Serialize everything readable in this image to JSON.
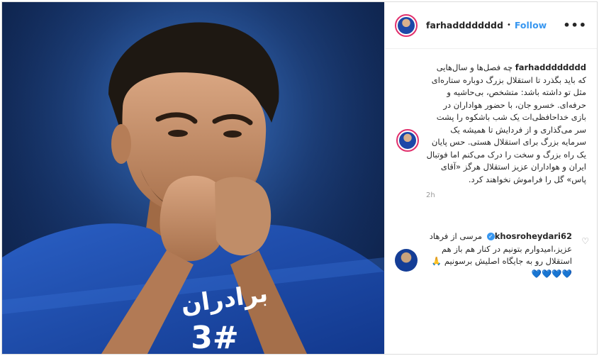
{
  "header": {
    "username": "farhadddddddd",
    "separator": "•",
    "follow_label": "Follow",
    "more_icon": "•••"
  },
  "caption": {
    "username": "farhadddddddd",
    "text": "چه فصل‌ها و سال‌هایی که باید بگذرد تا استقلال بزرگ دوباره ستاره‌ای مثل تو داشته باشد: متشخص، بی‌حاشیه و حرفه‌ای. خسرو جان، با حضور هواداران در بازی خداحافظی‌ات یک شب باشکوه را پشت سر می‌گذاری و از فردایش تا همیشه یک سرمایه بزرگ برای استقلال هستی. حس پایان یک راه بزرگ و سخت را درک می‌کنم اما فوتبال ایران و هواداران عزیز استقلال هرگز «آقای پاس» گل را فراموش نخواهند کرد.",
    "time": "2h"
  },
  "comment": {
    "username": "khosroheydari62",
    "verified_icon": "✓",
    "text": "مرسی از فرهاد عزیز،امیدوارم بتونیم در کنار هم باز هم استقلال رو به جایگاه اصلیش برسونیم 🙏💙💙💙💙",
    "like_icon": "♡"
  },
  "photo": {
    "jersey_sponsor": "برادران",
    "jersey_number": "3#"
  }
}
